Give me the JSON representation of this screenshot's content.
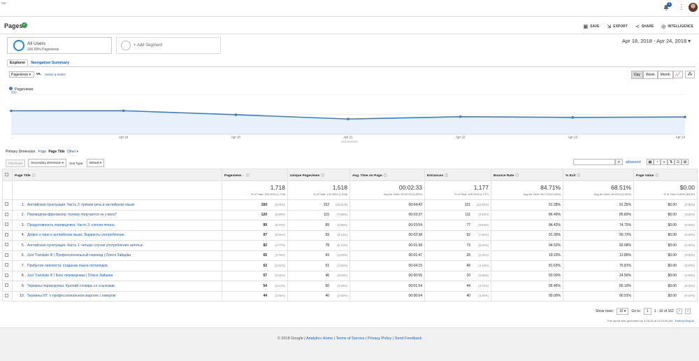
{
  "topbar": {
    "left_text": "ian",
    "notification_count": "1"
  },
  "header": {
    "title": "Pages",
    "actions": {
      "save": "SAVE",
      "export": "EXPORT",
      "share": "SHARE",
      "intelligence": "INTELLIGENCE"
    }
  },
  "segments": {
    "all_users": "All Users",
    "all_users_sub": "100.00% Pageviews",
    "add_segment": "+ Add Segment"
  },
  "date_range": "Apr 18, 2018 - Apr 24, 2018",
  "tabs": {
    "explorer": "Explorer",
    "nav_summary": "Navigation Summary"
  },
  "metric_select": {
    "value": "Pageviews",
    "vs": "vs.",
    "select_metric": "Select a metric"
  },
  "granularity": [
    "Day",
    "Week",
    "Month"
  ],
  "chart_data": {
    "type": "line",
    "series": [
      {
        "name": "Pageviews",
        "values": [
          295,
          296,
          246,
          192,
          221,
          212,
          218
        ]
      }
    ],
    "categories": [
      "Apr 18",
      "Apr 19",
      "Apr 20",
      "Apr 21",
      "Apr 22",
      "Apr 23",
      "Apr 24"
    ],
    "x_labels_shown": [
      "...",
      "Apr 19",
      "Apr 20",
      "Apr 21",
      "Apr 22",
      "Apr 23",
      "Apr 24"
    ],
    "ylim": [
      0,
      500
    ],
    "y_ticks": [
      "500",
      "250"
    ],
    "color": "#3c7dc4"
  },
  "primary_dimension": {
    "label": "Primary Dimension:",
    "options": [
      "Page",
      "Page Title",
      "Other"
    ],
    "selected": "Page Title"
  },
  "tooling": {
    "plot_rows": "Plot Rows",
    "secondary_dimension": "Secondary dimension",
    "sort_type_label": "Sort Type:",
    "sort_type": "Default",
    "advanced": "advanced"
  },
  "table": {
    "columns": [
      "Page Title",
      "Pageviews",
      "Unique Pageviews",
      "Avg. Time on Page",
      "Entrances",
      "Bounce Rate",
      "% Exit",
      "Page Value"
    ],
    "totals": [
      {
        "big": "1,718",
        "small": "% of Total: 100.00% (1,718)"
      },
      {
        "big": "1,518",
        "small": "% of Total: 100.00% (1,518)"
      },
      {
        "big": "00:02:33",
        "small": "Avg for View: 00:02:33 (0.00%)"
      },
      {
        "big": "1,177",
        "small": "% of Total: 100.00% (1,177)"
      },
      {
        "big": "84.71%",
        "small": "Avg for View: 84.71% (0.00%)"
      },
      {
        "big": "68.51%",
        "small": "Avg for View: 68.51% (0.00%)"
      },
      {
        "big": "$0.00",
        "small": "% of Total: 0.00% ($0.00)"
      }
    ],
    "rows": [
      {
        "n": "1.",
        "title": "Английская пунктуация. Часть 3: прямая речь в английском языке",
        "pv": "160",
        "pv_pct": "(9.31%)",
        "upv": "152",
        "upv_pct": "(10.01%)",
        "time": "00:04:42",
        "ent": "151",
        "ent_pct": "(12.83%)",
        "bounce": "91.39%",
        "exit": "91.25%",
        "value": "$0.00",
        "value_pct": "(0.00%)"
      },
      {
        "n": "2.",
        "title": "Переводчик-фрилансер: почему получается не у всех?",
        "pv": "120",
        "pv_pct": "(6.98%)",
        "upv": "115",
        "upv_pct": "(7.58%)",
        "time": "00:03:37",
        "ent": "111",
        "ent_pct": "(9.43%)",
        "bounce": "86.49%",
        "exit": "85.83%",
        "value": "$0.00",
        "value_pct": "(0.00%)"
      },
      {
        "n": "3.",
        "title": "Продуктивность переводчика. Часть 2: слепая печать",
        "pv": "99",
        "pv_pct": "(5.76%)",
        "upv": "89",
        "upv_pct": "(5.86%)",
        "time": "00:03:54",
        "ent": "77",
        "ent_pct": "(6.54%)",
        "bounce": "84.42%",
        "exit": "74.75%",
        "value": "$0.00",
        "value_pct": "(0.00%)"
      },
      {
        "n": "4.",
        "title": "Дефис и тире в английском языке. Варианты употребления.",
        "pv": "97",
        "pv_pct": "(5.65%)",
        "upv": "93",
        "upv_pct": "(6.13%)",
        "time": "00:02:38",
        "ent": "92",
        "ent_pct": "(7.82%)",
        "bounce": "91.30%",
        "exit": "90.72%",
        "value": "$0.00",
        "value_pct": "(0.00%)"
      },
      {
        "n": "5.",
        "title": "Английская пунктуация. Часть 1: четыре случая употребления запятых.",
        "pv": "82",
        "pv_pct": "(4.77%)",
        "upv": "78",
        "upv_pct": "(5.14%)",
        "time": "00:01:39",
        "ent": "73",
        "ent_pct": "(6.20%)",
        "bounce": "94.52%",
        "exit": "92.68%",
        "value": "$0.00",
        "value_pct": "(0.00%)"
      },
      {
        "n": "6.",
        "title": "Just Translate It! | Профессиональный перевод | Олеся Зайцева",
        "pv": "65",
        "pv_pct": "(3.78%)",
        "upv": "43",
        "upv_pct": "(2.83%)",
        "time": "00:01:47",
        "ent": "26",
        "ent_pct": "(2.21%)",
        "bounce": "19.23%",
        "exit": "13.85%",
        "value": "$0.00",
        "value_pct": "(0.00%)"
      },
      {
        "n": "7.",
        "title": "Прибытие лингвиста: создание языка гептаподов",
        "pv": "62",
        "pv_pct": "(3.61%)",
        "upv": "51",
        "upv_pct": "(3.36%)",
        "time": "00:04:15",
        "ent": "49",
        "ent_pct": "(4.16%)",
        "bounce": "81.63%",
        "exit": "75.81%",
        "value": "$0.00",
        "value_pct": "(0.00%)"
      },
      {
        "n": "8.",
        "title": "Just Translate It! | Блог переводчика | Олеся Зайцева",
        "pv": "57",
        "pv_pct": "(3.32%)",
        "upv": "46",
        "upv_pct": "(3.03%)",
        "time": "00:00:55",
        "ent": "10",
        "ent_pct": "(0.85%)",
        "bounce": "50.00%",
        "exit": "24.56%",
        "value": "$0.00",
        "value_pct": "(0.00%)"
      },
      {
        "n": "9.",
        "title": "Термины переводчика. Краткий словарь со ссылками.",
        "pv": "54",
        "pv_pct": "(3.14%)",
        "upv": "50",
        "upv_pct": "(3.29%)",
        "time": "00:01:54",
        "ent": "44",
        "ent_pct": "(3.74%)",
        "bounce": "95.45%",
        "exit": "85.19%",
        "value": "$0.00",
        "value_pct": "(0.00%)"
      },
      {
        "n": "10.",
        "title": "Термины ИТ: о профессиональном жаргоне с юмором",
        "pv": "44",
        "pv_pct": "(2.56%)",
        "upv": "40",
        "upv_pct": "(2.64%)",
        "time": "00:06:04",
        "ent": "40",
        "ent_pct": "(3.40%)",
        "bounce": "90.00%",
        "exit": "90.91%",
        "value": "$0.00",
        "value_pct": "(0.00%)"
      }
    ]
  },
  "pager": {
    "show_rows_label": "Show rows:",
    "show_rows": "10",
    "goto_label": "Go to:",
    "goto": "1",
    "range": "1 - 10 of 162"
  },
  "report_note": "This report was generated on 4/25/18 at 11:53:59 AM - ",
  "refresh_report": "Refresh Report",
  "footer": {
    "copyright": "© 2018 Google | ",
    "links": [
      "Analytics Home",
      "Terms of Service",
      "Privacy Policy",
      "Send Feedback"
    ]
  }
}
